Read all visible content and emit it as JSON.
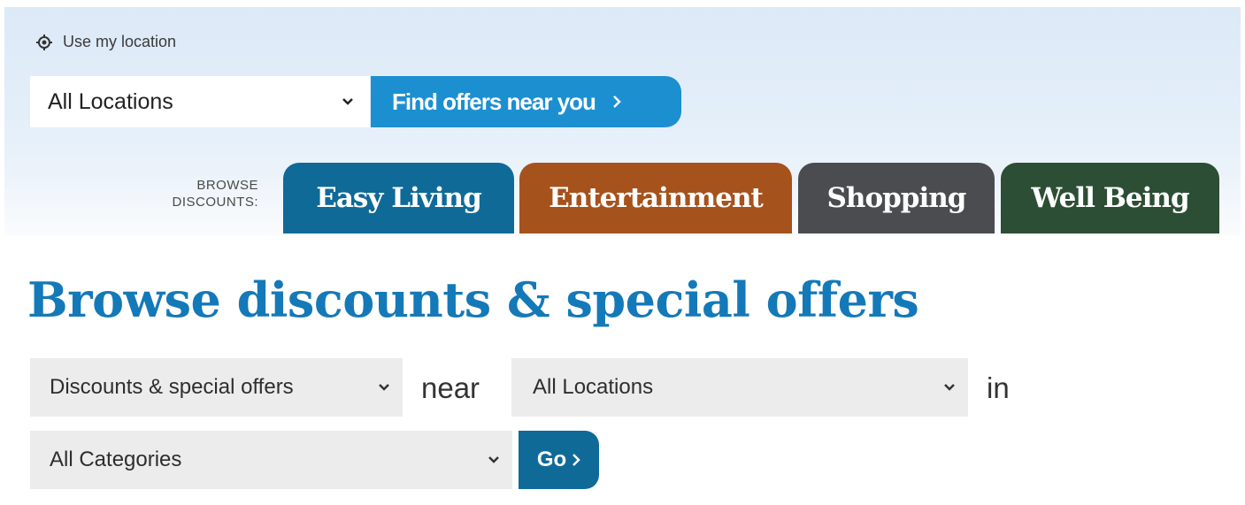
{
  "colors": {
    "accent_blue": "#1c8fd0",
    "title_blue": "#1479b8",
    "easy_living": "#0f6a97",
    "entertainment": "#a6521c",
    "shopping": "#4b4c4f",
    "well_being": "#2c4e34",
    "dropdown_bg": "#ececec"
  },
  "header": {
    "use_location_label": "Use my location",
    "use_location_icon": "location-target-icon",
    "location_select_value": "All Locations",
    "find_offers_label": "Find offers near you",
    "browse_label_line1": "BROWSE",
    "browse_label_line2": "DISCOUNTS:",
    "tabs": [
      {
        "label": "Easy Living"
      },
      {
        "label": "Entertainment"
      },
      {
        "label": "Shopping"
      },
      {
        "label": "Well Being"
      }
    ]
  },
  "main": {
    "title": "Browse discounts & special offers",
    "type_select_value": "Discounts & special offers",
    "near_word": "near",
    "location_select_value": "All Locations",
    "in_word": "in",
    "category_select_value": "All Categories",
    "go_label": "Go"
  }
}
